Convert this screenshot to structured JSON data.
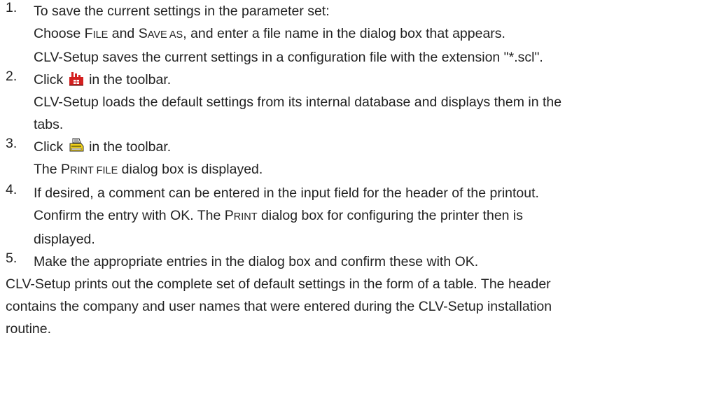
{
  "steps": [
    {
      "number": "1.",
      "line1": "To save the current settings in the parameter set:",
      "line2_pre": "Choose ",
      "file_f": "F",
      "file_rest": "ILE",
      "line2_and": " and ",
      "save_s": "S",
      "save_rest": "AVE AS",
      "line2_post": ", and enter a file name in the dialog box that appears.",
      "line3": "CLV-Setup saves the current settings in a configuration file with the extension \"*.scl\"."
    },
    {
      "number": "2.",
      "click_pre": "Click ",
      "click_post": " in the toolbar.",
      "icon": "factory-default-icon",
      "line2": "CLV-Setup loads the default settings from its internal database and displays them in the",
      "line3": "tabs."
    },
    {
      "number": "3.",
      "click_pre": "Click ",
      "click_post": " in the toolbar.",
      "icon": "printer-icon",
      "line2_pre": "The ",
      "printfile_p": "P",
      "printfile_rest": "RINT FILE",
      "line2_post": " dialog box is displayed."
    },
    {
      "number": "4.",
      "line1": "If desired, a comment can be entered in the input field for the header of the printout.",
      "line2_pre": "Confirm the entry with OK. The ",
      "print_p": "P",
      "print_rest": "RINT",
      "line2_post": " dialog box for configuring the printer then is",
      "line3": "displayed."
    },
    {
      "number": "5.",
      "line1": "Make the appropriate entries in the dialog box and confirm these with OK."
    }
  ],
  "closing": {
    "line1": "CLV-Setup prints out the complete set of default settings in the form of a table. The header",
    "line2": "contains the company and user names that were entered during the CLV-Setup installation",
    "line3": "routine."
  },
  "colors": {
    "text": "#222222",
    "factory_icon_red": "#d42020",
    "printer_icon_yellow": "#f2d21a"
  }
}
